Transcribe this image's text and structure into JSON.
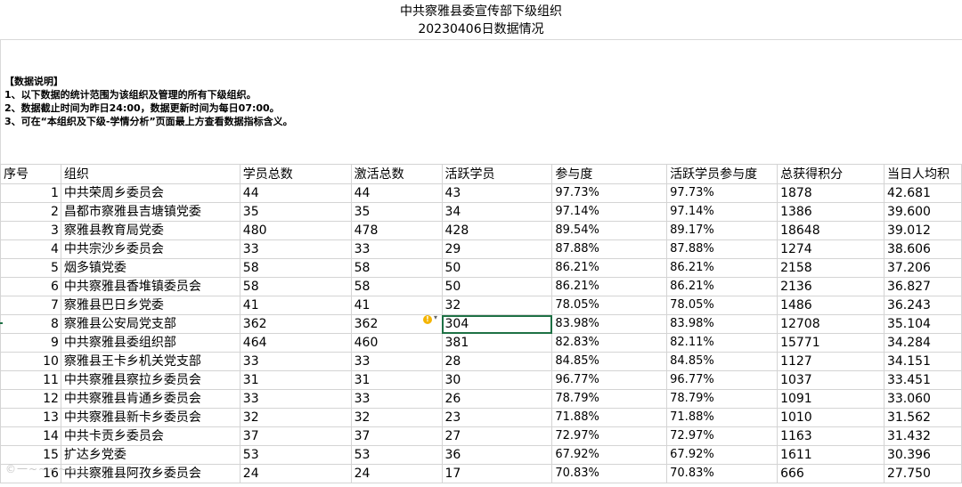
{
  "title": {
    "line1": "中共察雅县委宣传部下级组织",
    "line2": "20230406日数据情况"
  },
  "notes": {
    "heading": "【数据说明】",
    "items": [
      "1、以下数据的统计范围为该组织及管理的所有下级组织。",
      "2、数据截止时间为昨日24:00，数据更新时间为每日07:00。",
      "3、可在“本组织及下级-学情分析”页面最上方查看数据指标含义。"
    ]
  },
  "table": {
    "headers": [
      "序号",
      "组织",
      "学员总数",
      "激活总数",
      "活跃学员",
      "参与度",
      "活跃学员参与度",
      "总获得积分",
      "当日人均积"
    ],
    "rows": [
      [
        "1",
        "中共荣周乡委员会",
        "44",
        "44",
        "43",
        "97.73%",
        "97.73%",
        "1878",
        "42.681"
      ],
      [
        "2",
        "昌都市察雅县吉塘镇党委",
        "35",
        "35",
        "34",
        "97.14%",
        "97.14%",
        "1386",
        "39.600"
      ],
      [
        "3",
        "察雅县教育局党委",
        "480",
        "478",
        "428",
        "89.54%",
        "89.17%",
        "18648",
        "39.012"
      ],
      [
        "4",
        "中共宗沙乡委员会",
        "33",
        "33",
        "29",
        "87.88%",
        "87.88%",
        "1274",
        "38.606"
      ],
      [
        "5",
        "烟多镇党委",
        "58",
        "58",
        "50",
        "86.21%",
        "86.21%",
        "2158",
        "37.206"
      ],
      [
        "6",
        "中共察雅县香堆镇委员会",
        "58",
        "58",
        "50",
        "86.21%",
        "86.21%",
        "2136",
        "36.827"
      ],
      [
        "7",
        "察雅县巴日乡党委",
        "41",
        "41",
        "32",
        "78.05%",
        "78.05%",
        "1486",
        "36.243"
      ],
      [
        "8",
        "察雅县公安局党支部",
        "362",
        "362",
        "304",
        "83.98%",
        "83.98%",
        "12708",
        "35.104"
      ],
      [
        "9",
        "中共察雅县委组织部",
        "464",
        "460",
        "381",
        "82.83%",
        "82.11%",
        "15771",
        "34.284"
      ],
      [
        "10",
        "察雅县王卡乡机关党支部",
        "33",
        "33",
        "28",
        "84.85%",
        "84.85%",
        "1127",
        "34.151"
      ],
      [
        "11",
        "中共察雅县察拉乡委员会",
        "31",
        "31",
        "30",
        "96.77%",
        "96.77%",
        "1037",
        "33.451"
      ],
      [
        "12",
        "中共察雅县肯通乡委员会",
        "33",
        "33",
        "26",
        "78.79%",
        "78.79%",
        "1091",
        "33.060"
      ],
      [
        "13",
        "中共察雅县新卡乡委员会",
        "32",
        "32",
        "23",
        "71.88%",
        "71.88%",
        "1010",
        "31.562"
      ],
      [
        "14",
        "中共卡贡乡委员会",
        "37",
        "37",
        "27",
        "72.97%",
        "72.97%",
        "1163",
        "31.432"
      ],
      [
        "15",
        "扩达乡党委",
        "53",
        "53",
        "36",
        "67.92%",
        "67.92%",
        "1611",
        "30.396"
      ],
      [
        "16",
        "中共察雅县阿孜乡委员会",
        "24",
        "24",
        "17",
        "70.83%",
        "70.83%",
        "666",
        "27.750"
      ]
    ]
  },
  "warning_icon": "warning-circle-icon",
  "watermark": "©一~~~~~~"
}
